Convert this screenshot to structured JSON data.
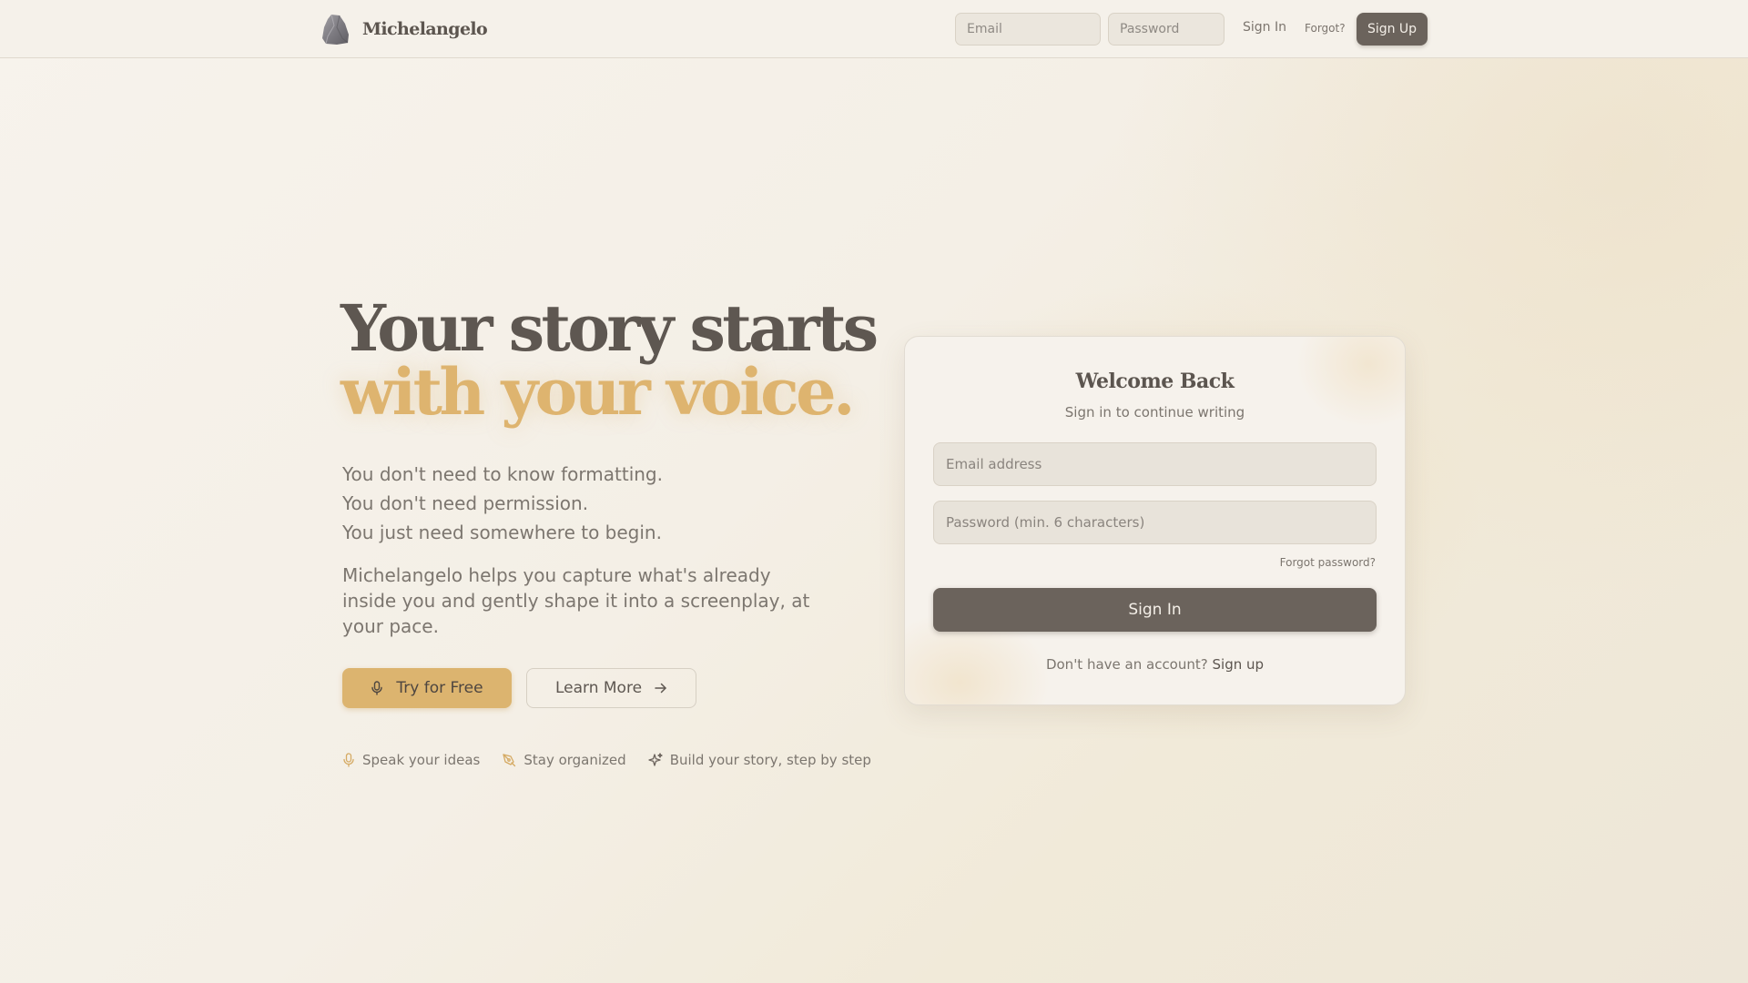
{
  "header": {
    "brand": "Michelangelo",
    "email_placeholder": "Email",
    "password_placeholder": "Password",
    "sign_in": "Sign In",
    "forgot": "Forgot?",
    "sign_up": "Sign Up"
  },
  "hero": {
    "title_line1": "Your story starts",
    "title_line2": "with your voice.",
    "lines": [
      "You don't need to know formatting.",
      "You don't need permission.",
      "You just need somewhere to begin."
    ],
    "description": "Michelangelo helps you capture what's already inside you and gently shape it into a screenplay, at your pace.",
    "try_button": "Try for Free",
    "learn_button": "Learn More",
    "features": [
      {
        "label": "Speak your ideas",
        "icon": "mic-icon"
      },
      {
        "label": "Stay organized",
        "icon": "pen-tool-icon"
      },
      {
        "label": "Build your story, step by step",
        "icon": "sparkles-icon"
      }
    ]
  },
  "login_card": {
    "title": "Welcome Back",
    "subtitle": "Sign in to continue writing",
    "email_placeholder": "Email address",
    "password_placeholder": "Password (min. 6 characters)",
    "forgot": "Forgot password?",
    "sign_in": "Sign In",
    "no_account": "Don't have an account?",
    "sign_up": "Sign up"
  },
  "colors": {
    "accent": "#dcb46f",
    "primary_dark": "#6b635c",
    "background": "#f5f1ea"
  }
}
